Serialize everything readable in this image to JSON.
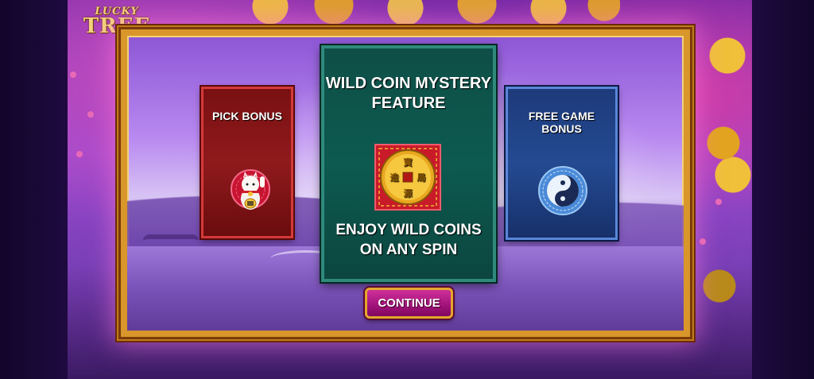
{
  "game": {
    "logo_line1": "LUCKY",
    "logo_line2": "TREE"
  },
  "cards": {
    "pick_bonus": {
      "title": "PICK BONUS",
      "icon": "lucky-cat-icon",
      "color": "#8f1a1c"
    },
    "wild_coin": {
      "title": "WILD COIN MYSTERY FEATURE",
      "subtitle": "ENJOY WILD COINS ON ANY SPIN",
      "icon": "gold-coin-icon",
      "coin_text": "寳 局 造 源",
      "color": "#0d5a50"
    },
    "free_game": {
      "title": "FREE GAME BONUS",
      "icon": "yin-yang-icon",
      "color": "#244a92"
    }
  },
  "continue_button": {
    "label": "CONTINUE",
    "color": "#c02890",
    "border": "#e4a72e"
  },
  "colors": {
    "frame_gold": "#d9962a",
    "background_purple": "#7a2aa6"
  }
}
